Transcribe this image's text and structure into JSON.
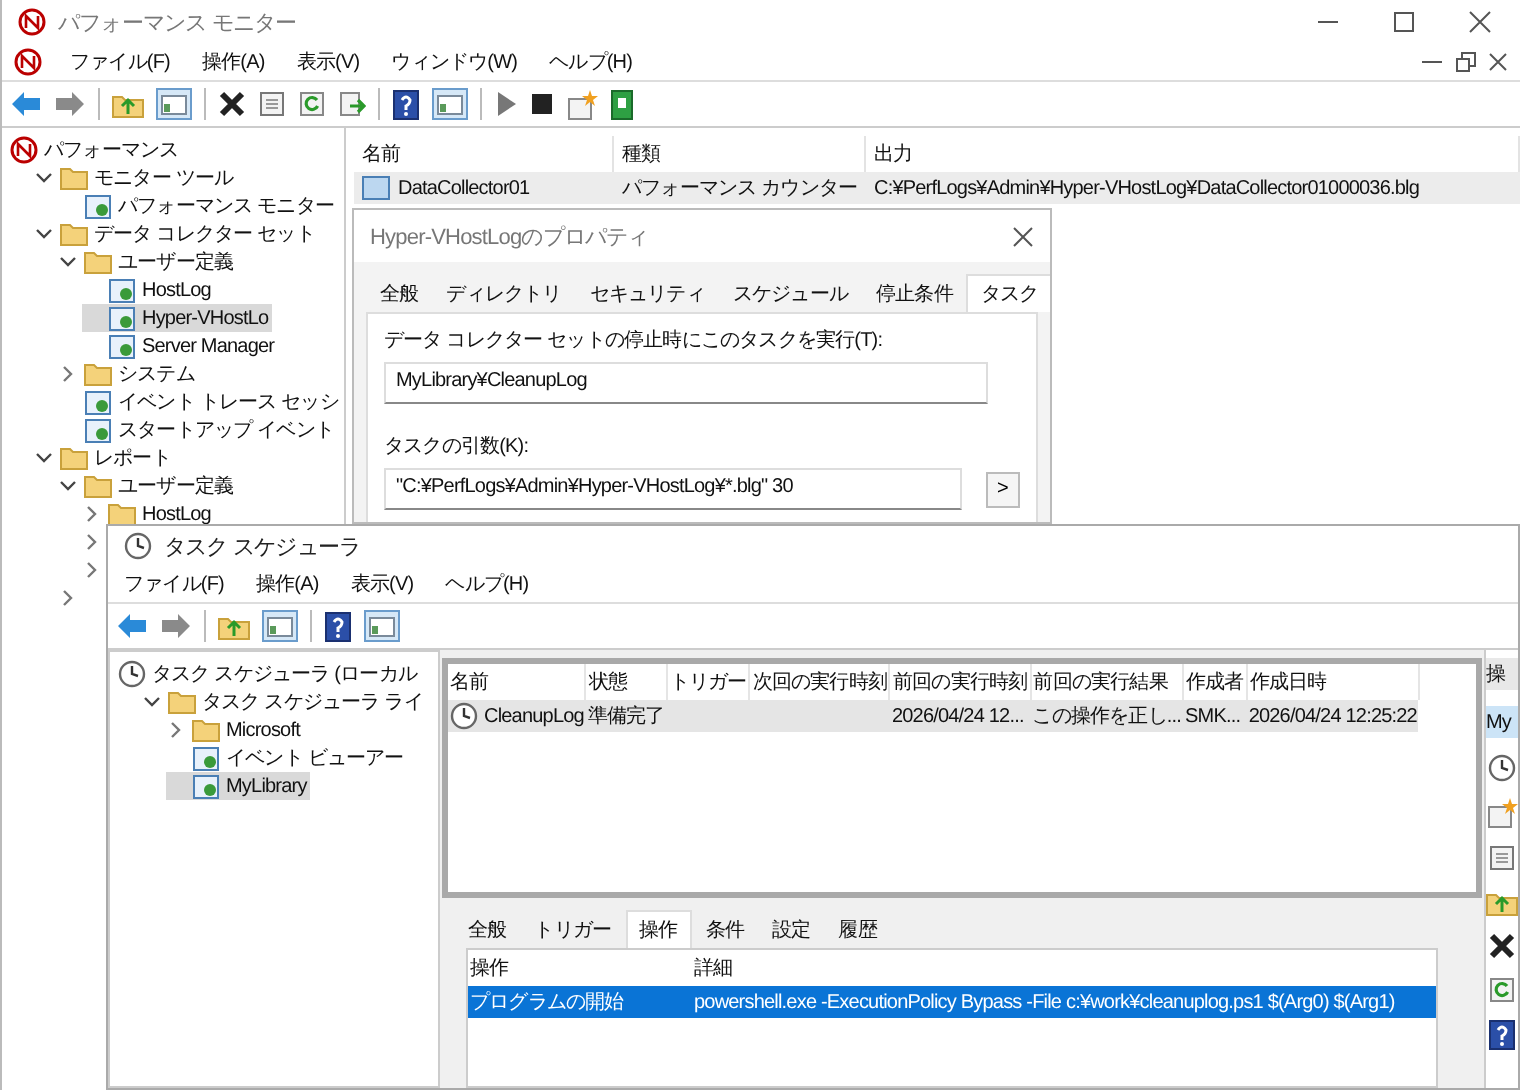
{
  "perf_monitor": {
    "title": "パフォーマンス モニター",
    "menu": [
      "ファイル(F)",
      "操作(A)",
      "表示(V)",
      "ウィンドウ(W)",
      "ヘルプ(H)"
    ],
    "tree": [
      {
        "label": "パフォーマンス",
        "selected": false,
        "children": [
          {
            "label": "モニター ツール",
            "expanded": true,
            "selected": false,
            "children": [
              {
                "label": "パフォーマンス モニター",
                "selected": false
              }
            ]
          },
          {
            "label": "データ コレクター セット",
            "expanded": true,
            "selected": false,
            "children": [
              {
                "label": "ユーザー定義",
                "expanded": true,
                "selected": false,
                "children": [
                  {
                    "label": "HostLog",
                    "selected": false
                  },
                  {
                    "label": "Hyper-VHostLo",
                    "selected": true
                  },
                  {
                    "label": "Server Manager",
                    "selected": false
                  }
                ]
              },
              {
                "label": "システム",
                "expanded": false,
                "selected": false
              },
              {
                "label": "イベント トレース セッシ",
                "selected": false
              },
              {
                "label": "スタートアップ イベント",
                "selected": false
              }
            ]
          },
          {
            "label": "レポート",
            "expanded": true,
            "selected": false,
            "children": [
              {
                "label": "ユーザー定義",
                "expanded": true,
                "selected": false,
                "children": [
                  {
                    "label": "HostLog",
                    "expanded": false,
                    "selected": false
                  },
                  {
                    "expanded": false
                  },
                  {
                    "expanded": false
                  }
                ]
              },
              {
                "expanded": false
              }
            ]
          }
        ]
      }
    ],
    "list": {
      "columns": [
        "名前",
        "種類",
        "出力"
      ],
      "rows": [
        {
          "cells": [
            "DataCollector01",
            "パフォーマンス カウンター",
            "C:¥PerfLogs¥Admin¥Hyper-VHostLog¥DataCollector01000036.blg"
          ],
          "selected": true
        }
      ]
    }
  },
  "properties_dialog": {
    "title": "Hyper-VHostLogのプロパティ",
    "tabs": [
      {
        "label": "全般",
        "selected": false
      },
      {
        "label": "ディレクトリ",
        "selected": false
      },
      {
        "label": "セキュリティ",
        "selected": false
      },
      {
        "label": "スケジュール",
        "selected": false
      },
      {
        "label": "停止条件",
        "selected": false
      },
      {
        "label": "タスク",
        "selected": true
      }
    ],
    "task_label": "データ コレクター セットの停止時にこのタスクを実行(T):",
    "task_value": "MyLibrary¥CleanupLog",
    "arguments_label": "タスクの引数(K):",
    "arguments_value": "\"C:¥PerfLogs¥Admin¥Hyper-VHostLog¥*.blg\" 30",
    "arguments_button": ">"
  },
  "task_scheduler": {
    "title": "タスク スケジューラ",
    "menu": [
      "ファイル(F)",
      "操作(A)",
      "表示(V)",
      "ヘルプ(H)"
    ],
    "tree": [
      {
        "label": "タスク スケジューラ (ローカル",
        "selected": false,
        "children": [
          {
            "label": "タスク スケジューラ ライ",
            "expanded": true,
            "selected": false,
            "children": [
              {
                "label": "Microsoft",
                "expanded": false,
                "selected": false
              },
              {
                "label": "イベント ビューアー",
                "selected": false
              },
              {
                "label": "MyLibrary",
                "selected": true
              }
            ]
          }
        ]
      }
    ],
    "tasks": {
      "columns": [
        "名前",
        "状態",
        "トリガー",
        "次回の実行時刻",
        "前回の実行時刻",
        "前回の実行結果",
        "作成者",
        "作成日時"
      ],
      "rows": [
        {
          "cells": [
            "CleanupLog",
            "準備完了",
            null,
            null,
            "2026/04/24 12...",
            "この操作を正し...",
            "SMK...",
            "2026/04/24 12:25:22"
          ],
          "selected": true
        }
      ]
    },
    "actions_pane": {
      "header": "操",
      "items": [
        {
          "label": "My",
          "selected": true
        }
      ]
    },
    "detail_tabs": [
      {
        "label": "全般",
        "selected": false
      },
      {
        "label": "トリガー",
        "selected": false
      },
      {
        "label": "操作",
        "selected": true
      },
      {
        "label": "条件",
        "selected": false
      },
      {
        "label": "設定",
        "selected": false
      },
      {
        "label": "履歴",
        "selected": false
      }
    ],
    "actions": {
      "columns": [
        "操作",
        "詳細"
      ],
      "rows": [
        {
          "cells": [
            "プログラムの開始",
            "powershell.exe -ExecutionPolicy Bypass -File c:¥work¥cleanuplog.ps1 $(Arg0) $(Arg1)"
          ],
          "selected": true
        }
      ]
    }
  }
}
